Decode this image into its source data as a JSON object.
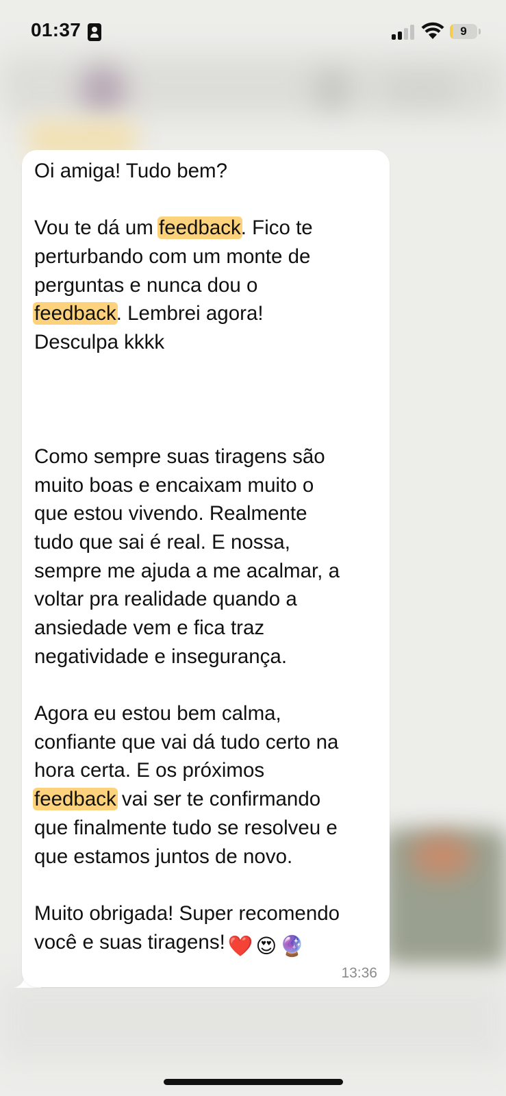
{
  "status_bar": {
    "time": "01:37",
    "battery_level": "9",
    "battery_fraction": 0.09
  },
  "message": {
    "lines": [
      "Oi amiga! Tudo bem?",
      "",
      [
        "Vou te dá um ",
        "feedback",
        ". Fico te"
      ],
      "perturbando com um monte de",
      "perguntas e nunca dou o",
      [
        "",
        "feedback",
        ". Lembrei agora!"
      ],
      "Desculpa kkkk",
      "",
      "",
      "",
      "Como sempre suas tiragens são",
      "muito boas e encaixam muito o",
      "que estou vivendo. Realmente",
      "tudo que sai é real. E nossa,",
      "sempre me ajuda a me acalmar, a",
      "voltar pra realidade quando a",
      "ansiedade vem e fica traz",
      "negatividade e insegurança.",
      "",
      "Agora eu estou bem calma,",
      "confiante que vai dá tudo certo na",
      "hora certa. E os próximos",
      [
        "",
        "feedback",
        " vai ser te confirmando"
      ],
      "que finalmente tudo se resolveu e",
      "que estamos juntos de novo.",
      "",
      "Muito obrigada! Super recomendo",
      "você e suas tiragens!"
    ],
    "emojis": [
      "heart-emoji",
      "heart-eyes-emoji",
      "crystal-ball-emoji"
    ],
    "time": "13:36",
    "highlight_color": "#fcd27c"
  }
}
